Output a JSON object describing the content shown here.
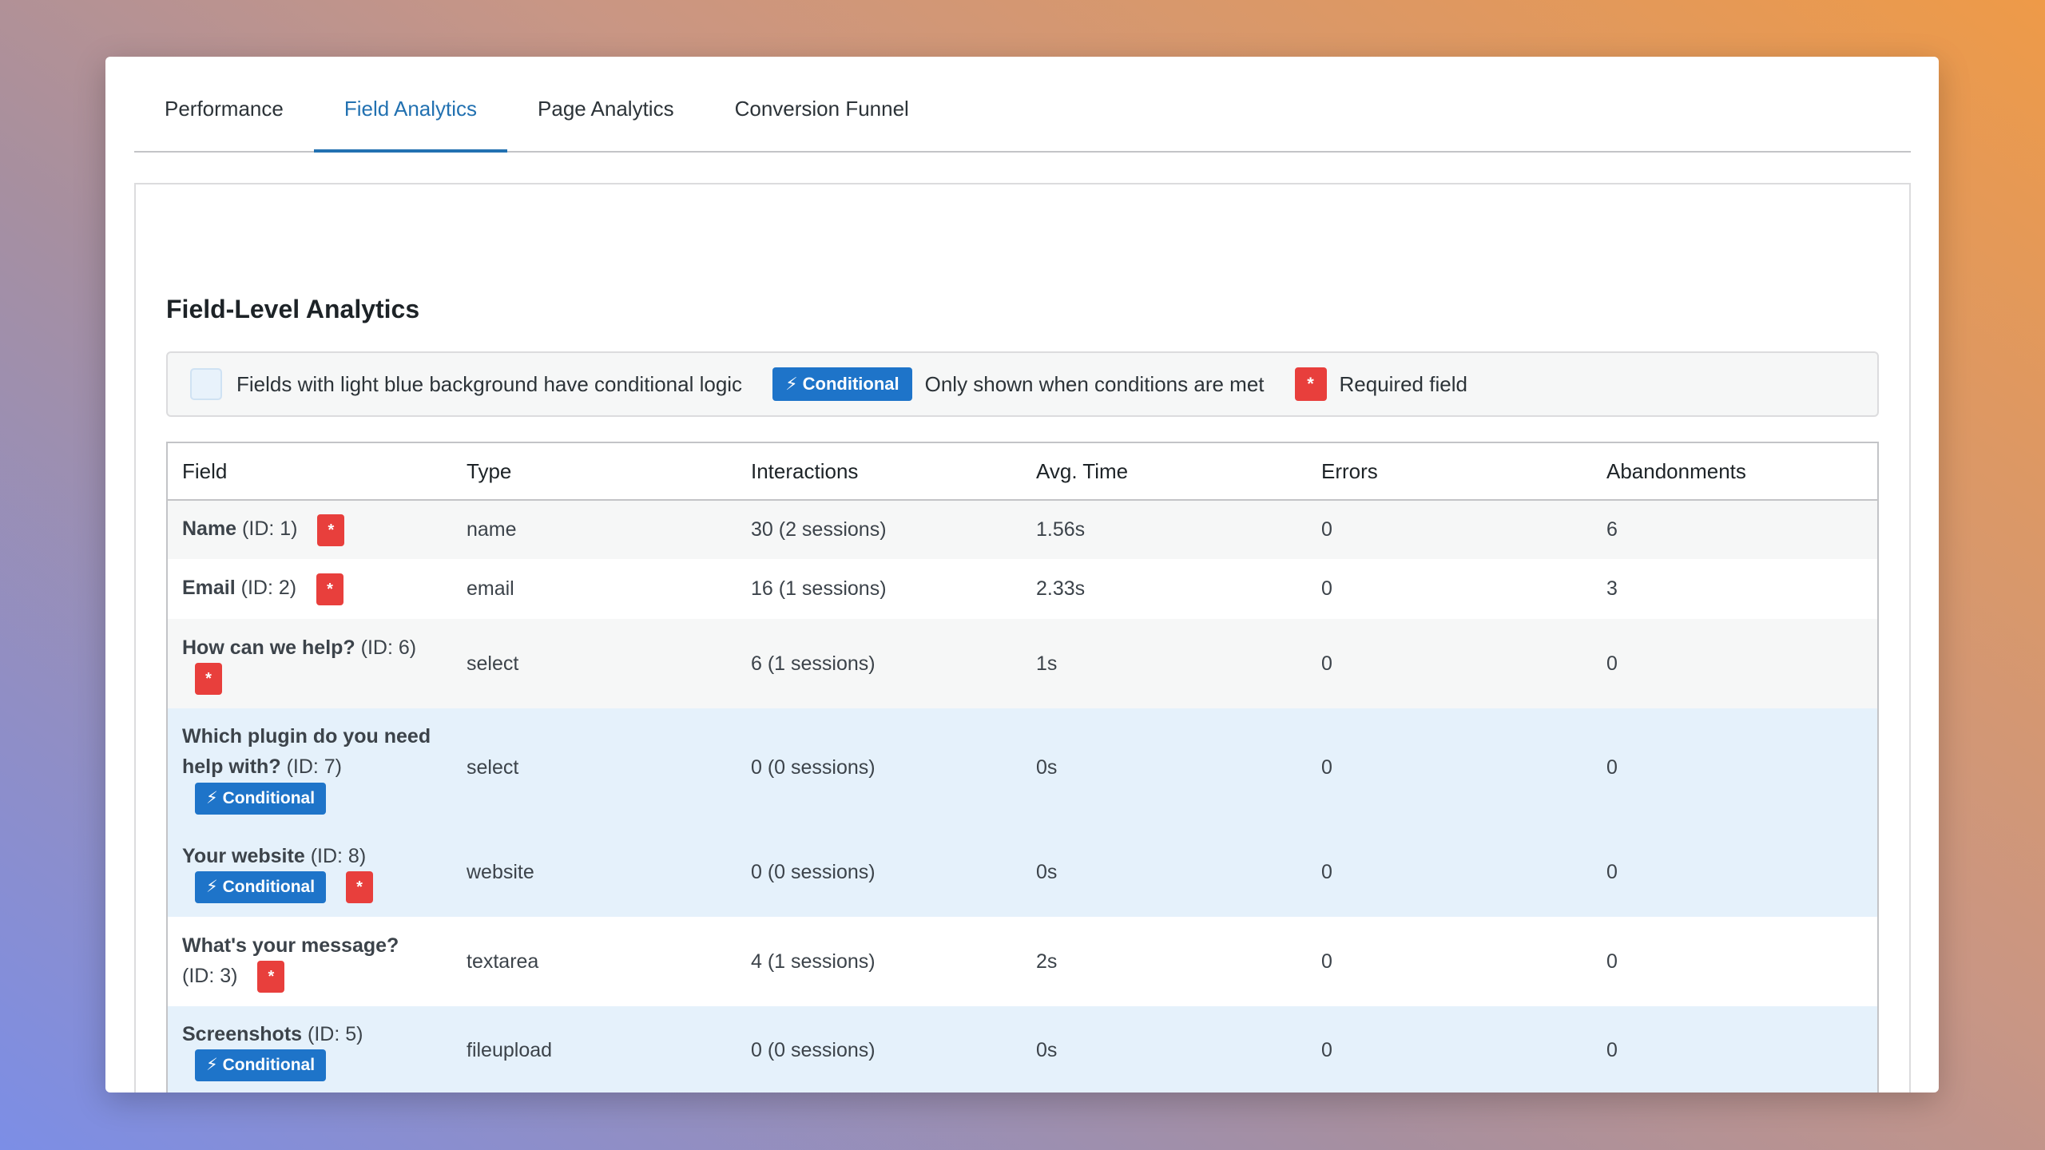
{
  "tabs": [
    {
      "label": "Performance"
    },
    {
      "label": "Field Analytics"
    },
    {
      "label": "Page Analytics"
    },
    {
      "label": "Conversion Funnel"
    }
  ],
  "active_tab": "Field Analytics",
  "section_title": "Field-Level Analytics",
  "legend": {
    "conditional_bg_text": "Fields with light blue background have conditional logic",
    "conditional_badge": "⚡ Conditional",
    "conditional_text": "Only shown when conditions are met",
    "required_badge": "*",
    "required_text": "Required field"
  },
  "colors": {
    "accent": "#2271b1",
    "conditional_badge": "#1e74c9",
    "required_badge": "#e83f3c",
    "conditional_row": "#e5f1fb"
  },
  "table": {
    "headers": [
      "Field",
      "Type",
      "Interactions",
      "Avg. Time",
      "Errors",
      "Abandonments"
    ],
    "rows": [
      {
        "name": "Name",
        "id": "(ID: 1)",
        "type": "name",
        "interactions": "30 (2 sessions)",
        "avg_time": "1.56s",
        "errors": "0",
        "abandonments": "6"
      },
      {
        "name": "Email",
        "id": "(ID: 2)",
        "type": "email",
        "interactions": "16 (1 sessions)",
        "avg_time": "2.33s",
        "errors": "0",
        "abandonments": "3"
      },
      {
        "name": "How can we help?",
        "id": "(ID: 6)",
        "type": "select",
        "interactions": "6 (1 sessions)",
        "avg_time": "1s",
        "errors": "0",
        "abandonments": "0"
      },
      {
        "name": "Which plugin do you need help with?",
        "id": "(ID: 7)",
        "type": "select",
        "interactions": "0 (0 sessions)",
        "avg_time": "0s",
        "errors": "0",
        "abandonments": "0"
      },
      {
        "name": "Your website",
        "id": "(ID: 8)",
        "type": "website",
        "interactions": "0 (0 sessions)",
        "avg_time": "0s",
        "errors": "0",
        "abandonments": "0"
      },
      {
        "name": "What's your message?",
        "id": "(ID: 3)",
        "type": "textarea",
        "interactions": "4 (1 sessions)",
        "avg_time": "2s",
        "errors": "0",
        "abandonments": "0"
      },
      {
        "name": "Screenshots",
        "id": "(ID: 5)",
        "type": "fileupload",
        "interactions": "0 (0 sessions)",
        "avg_time": "0s",
        "errors": "0",
        "abandonments": "0"
      }
    ]
  }
}
